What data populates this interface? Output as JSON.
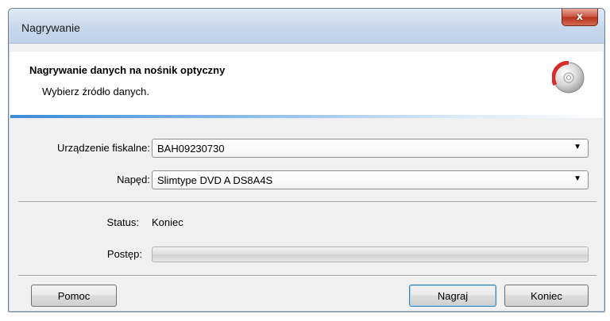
{
  "window": {
    "title": "Nagrywanie",
    "close_glyph": "x"
  },
  "header": {
    "title": "Nagrywanie danych na nośnik optyczny",
    "subtitle": "Wybierz źródło danych.",
    "icon": "optical-disc-icon"
  },
  "form": {
    "device_label": "Urządzenie fiskalne:",
    "device_value": "BAH09230730",
    "drive_label": "Napęd:",
    "drive_value": "Slimtype DVD A DS8A4S",
    "status_label": "Status:",
    "status_value": "Koniec",
    "progress_label": "Postęp:",
    "progress_percent": 0
  },
  "buttons": {
    "help": "Pomoc",
    "burn": "Nagraj",
    "end": "Koniec"
  },
  "colors": {
    "accent_line": "#3d89d8",
    "disc_red": "#d62b2b"
  }
}
